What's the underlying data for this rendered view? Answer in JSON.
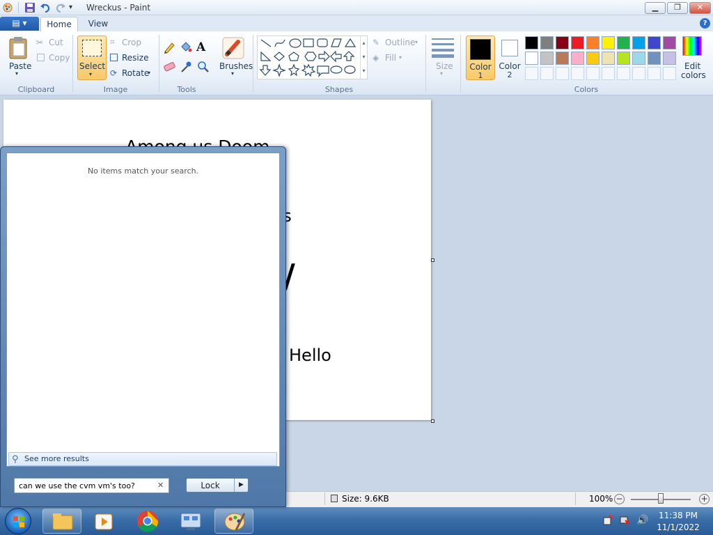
{
  "window": {
    "title": "Wreckus - Paint",
    "minimize": "▁",
    "restore": "❐",
    "close": "✕"
  },
  "tabs": {
    "file": "▤ ▾",
    "home": "Home",
    "view": "View"
  },
  "clipboard": {
    "label": "Clipboard",
    "paste": "Paste",
    "cut": "Cut",
    "copy": "Copy"
  },
  "image": {
    "label": "Image",
    "select": "Select",
    "crop": "Crop",
    "resize": "Resize",
    "rotate": "Rotate"
  },
  "tools": {
    "label": "Tools"
  },
  "brushes": {
    "label": "Brushes"
  },
  "shapes": {
    "label": "Shapes",
    "outline": "Outline",
    "fill": "Fill",
    "size": "Size"
  },
  "colors": {
    "label": "Colors",
    "color1": "Color",
    "color1_num": "1",
    "color2": "Color",
    "color2_num": "2",
    "edit": "Edit",
    "edit2": "colors",
    "color1_value": "#000000",
    "color2_value": "#ffffff",
    "palette_row1": [
      "#000000",
      "#7f7f7f",
      "#880015",
      "#ed1c24",
      "#ff7f27",
      "#fff200",
      "#22b14c",
      "#00a2e8",
      "#3f48cc",
      "#a349a4"
    ],
    "palette_row2": [
      "#ffffff",
      "#c3c3c3",
      "#b97a57",
      "#ffaec9",
      "#ffc90e",
      "#efe4b0",
      "#b5e61d",
      "#99d9ea",
      "#7092be",
      "#c8bfe7"
    ]
  },
  "canvas": {
    "line1": "Among us Doom",
    "line2": "2s",
    "line3": "/",
    "line4": "Hello"
  },
  "status": {
    "size": "Size: 9.6KB",
    "zoom": "100%",
    "zoom_level": 1.0
  },
  "startmenu": {
    "no_items": "No items match your search.",
    "see_more": "See more results",
    "search_value": "can we use the cvm vm's too?",
    "lock": "Lock"
  },
  "clock": {
    "time": "11:38 PM",
    "date": "11/1/2022"
  }
}
